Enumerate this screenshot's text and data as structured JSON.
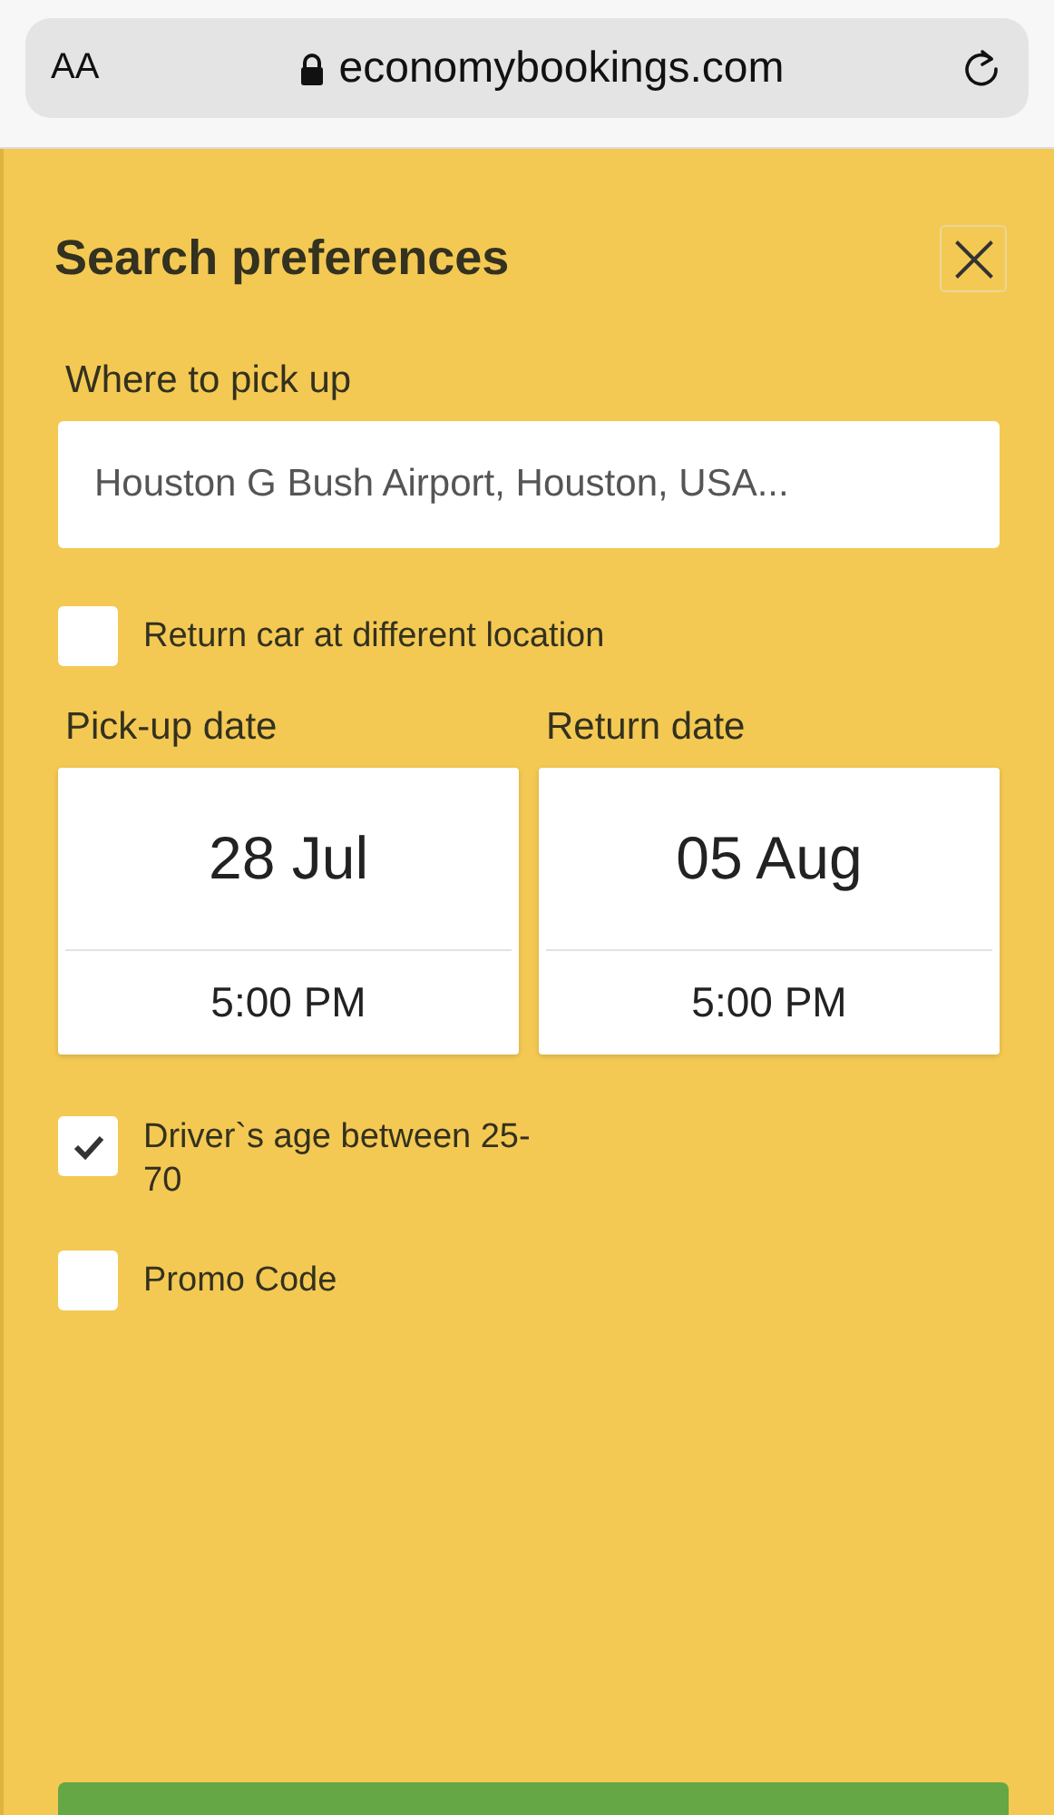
{
  "browser": {
    "text_size_button": "AA",
    "url": "economybookings.com"
  },
  "panel": {
    "title": "Search preferences",
    "pickup": {
      "label": "Where to pick up",
      "value": "Houston G Bush Airport, Houston, USA..."
    },
    "return_elsewhere": {
      "label": "Return car at different location",
      "checked": false
    },
    "dates": [
      {
        "label": "Pick-up date",
        "date": "28 Jul",
        "time": "5:00 PM"
      },
      {
        "label": "Return date",
        "date": "05 Aug",
        "time": "5:00 PM"
      }
    ],
    "options": [
      {
        "label": "Driver`s age between 25-70",
        "checked": true
      },
      {
        "label": "Promo Code",
        "checked": false
      }
    ]
  }
}
